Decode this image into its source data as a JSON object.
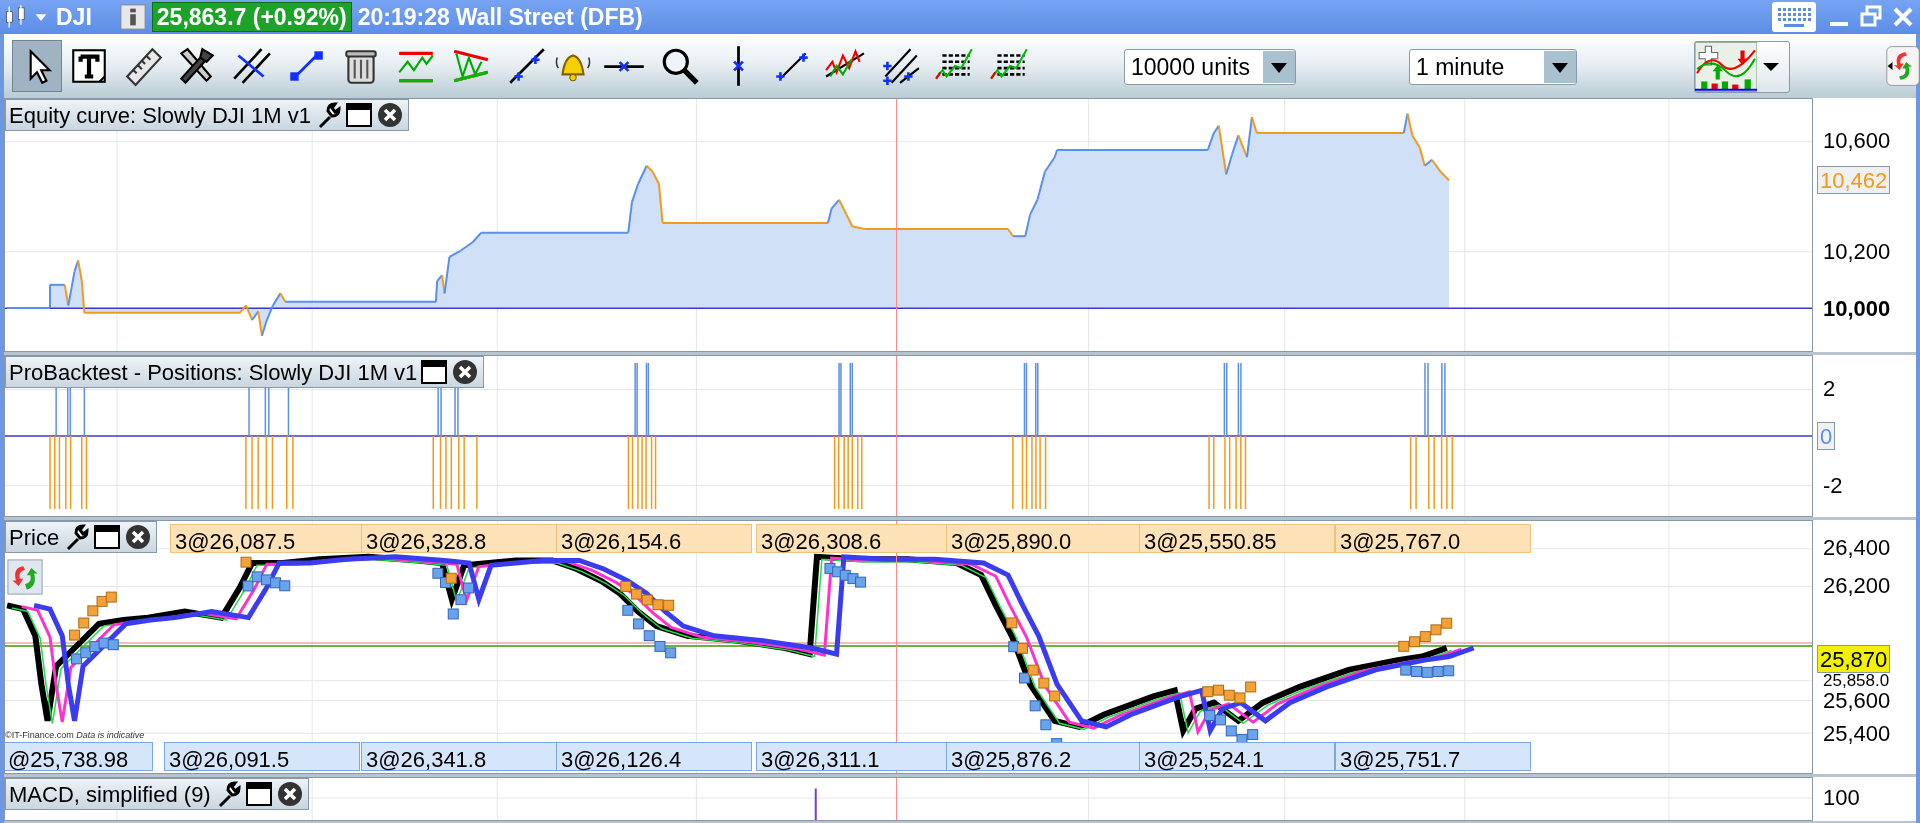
{
  "title_bar": {
    "instrument": "DJI",
    "price": "25,863.7 (+0.92%)",
    "time": "20:19:28",
    "market": "Wall Street (DFB)"
  },
  "toolbar": {
    "tools": [
      {
        "kind": "pointer",
        "selected": true
      },
      {
        "kind": "text",
        "selected": false
      },
      {
        "kind": "ruler",
        "selected": false
      },
      {
        "kind": "tools",
        "selected": false
      },
      {
        "kind": "parallel",
        "selected": false
      },
      {
        "kind": "segment",
        "selected": false
      },
      {
        "kind": "trash",
        "selected": false
      },
      {
        "kind": "channel",
        "selected": false
      },
      {
        "kind": "wedge",
        "selected": false
      },
      {
        "kind": "line",
        "selected": false
      },
      {
        "kind": "bell",
        "selected": false
      },
      {
        "kind": "horizontal",
        "selected": false
      },
      {
        "kind": "magnifier",
        "selected": false
      },
      {
        "kind": "vertical",
        "selected": false
      },
      {
        "kind": "ray",
        "selected": false
      },
      {
        "kind": "zigzag",
        "selected": false
      },
      {
        "kind": "fan",
        "selected": false
      },
      {
        "kind": "report",
        "selected": false
      },
      {
        "kind": "report",
        "selected": false
      }
    ],
    "quantity": "10000 units",
    "timeframe": "1 minute"
  },
  "panels": [
    {
      "kind": "equity",
      "title": "Equity curve: Slowly DJI 1M v1",
      "axis_labels": [
        {
          "text": "10,600",
          "bold": false
        },
        {
          "text": "10,200",
          "bold": false
        },
        {
          "text": "10,000",
          "bold": true
        }
      ],
      "last_value": "10,462"
    },
    {
      "kind": "positions",
      "title": "ProBacktest - Positions: Slowly DJI 1M v1",
      "axis_labels": [
        {
          "text": "2",
          "bold": false
        },
        {
          "text": "-2",
          "bold": false
        }
      ],
      "last_value": "0"
    },
    {
      "kind": "price",
      "title": "Price",
      "axis_labels": [
        {
          "text": "26,400",
          "bold": false
        },
        {
          "text": "26,200",
          "bold": false
        },
        {
          "text": "25,858.0",
          "bold": false
        },
        {
          "text": "25,600",
          "bold": false
        },
        {
          "text": "25,400",
          "bold": false
        }
      ],
      "last_value": "25,870",
      "sell_tags": [
        "3@26,087.5",
        "3@26,328.8",
        "3@26,154.6",
        "3@26,308.6",
        "3@25,890.0",
        "3@25,550.85",
        "3@25,767.0"
      ],
      "buy_tags": [
        "@25,738.98",
        "3@26,091.5",
        "3@26,341.8",
        "3@26,126.4",
        "3@26,311.1",
        "3@25,876.2",
        "3@25,524.1",
        "3@25,751.7"
      ],
      "notice": "©IT-Finance.com *Data is indicative*"
    },
    {
      "kind": "macd",
      "title": "MACD, simplified (9)",
      "axis_labels": [
        {
          "text": "100",
          "bold": false
        }
      ]
    }
  ]
}
